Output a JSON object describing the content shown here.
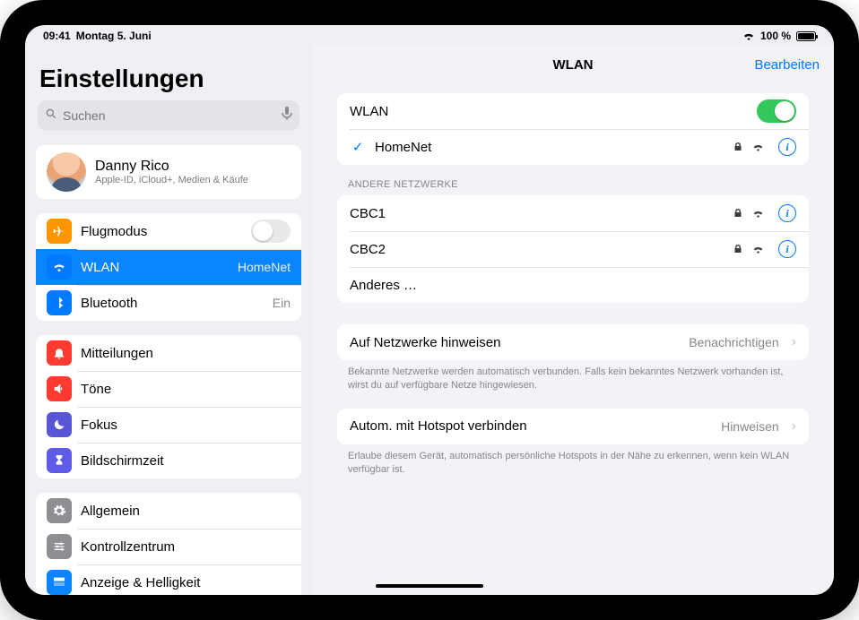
{
  "status": {
    "time": "09:41",
    "date": "Montag 5. Juni",
    "battery_pct": "100 %"
  },
  "sidebar": {
    "title": "Einstellungen",
    "search_placeholder": "Suchen",
    "profile": {
      "name": "Danny Rico",
      "subtitle": "Apple-ID, iCloud+, Medien & Käufe"
    },
    "group_connectivity": {
      "flugmodus": "Flugmodus",
      "wlan": "WLAN",
      "wlan_value": "HomeNet",
      "bluetooth": "Bluetooth",
      "bluetooth_value": "Ein"
    },
    "group_notifications": {
      "mitteilungen": "Mitteilungen",
      "toene": "Töne",
      "fokus": "Fokus",
      "bildschirmzeit": "Bildschirmzeit"
    },
    "group_general": {
      "allgemein": "Allgemein",
      "kontrollzentrum": "Kontrollzentrum",
      "anzeige": "Anzeige & Helligkeit"
    }
  },
  "detail": {
    "title": "WLAN",
    "edit_label": "Bearbeiten",
    "wlan_toggle_label": "WLAN",
    "connected_network": "HomeNet",
    "other_section_title": "Andere Netzwerke",
    "networks": [
      {
        "name": "CBC1",
        "secure": true
      },
      {
        "name": "CBC2",
        "secure": true
      }
    ],
    "other_label": "Anderes …",
    "ask_join": {
      "label": "Auf Netzwerke hinweisen",
      "value": "Benachrichtigen",
      "footnote": "Bekannte Netzwerke werden automatisch verbunden. Falls kein bekanntes Netzwerk vorhanden ist, wirst du auf verfügbare Netze hingewiesen."
    },
    "hotspot": {
      "label": "Autom. mit Hotspot verbinden",
      "value": "Hinweisen",
      "footnote": "Erlaube diesem Gerät, automatisch persönliche Hotspots in der Nähe zu erkennen, wenn kein WLAN verfügbar ist."
    }
  }
}
